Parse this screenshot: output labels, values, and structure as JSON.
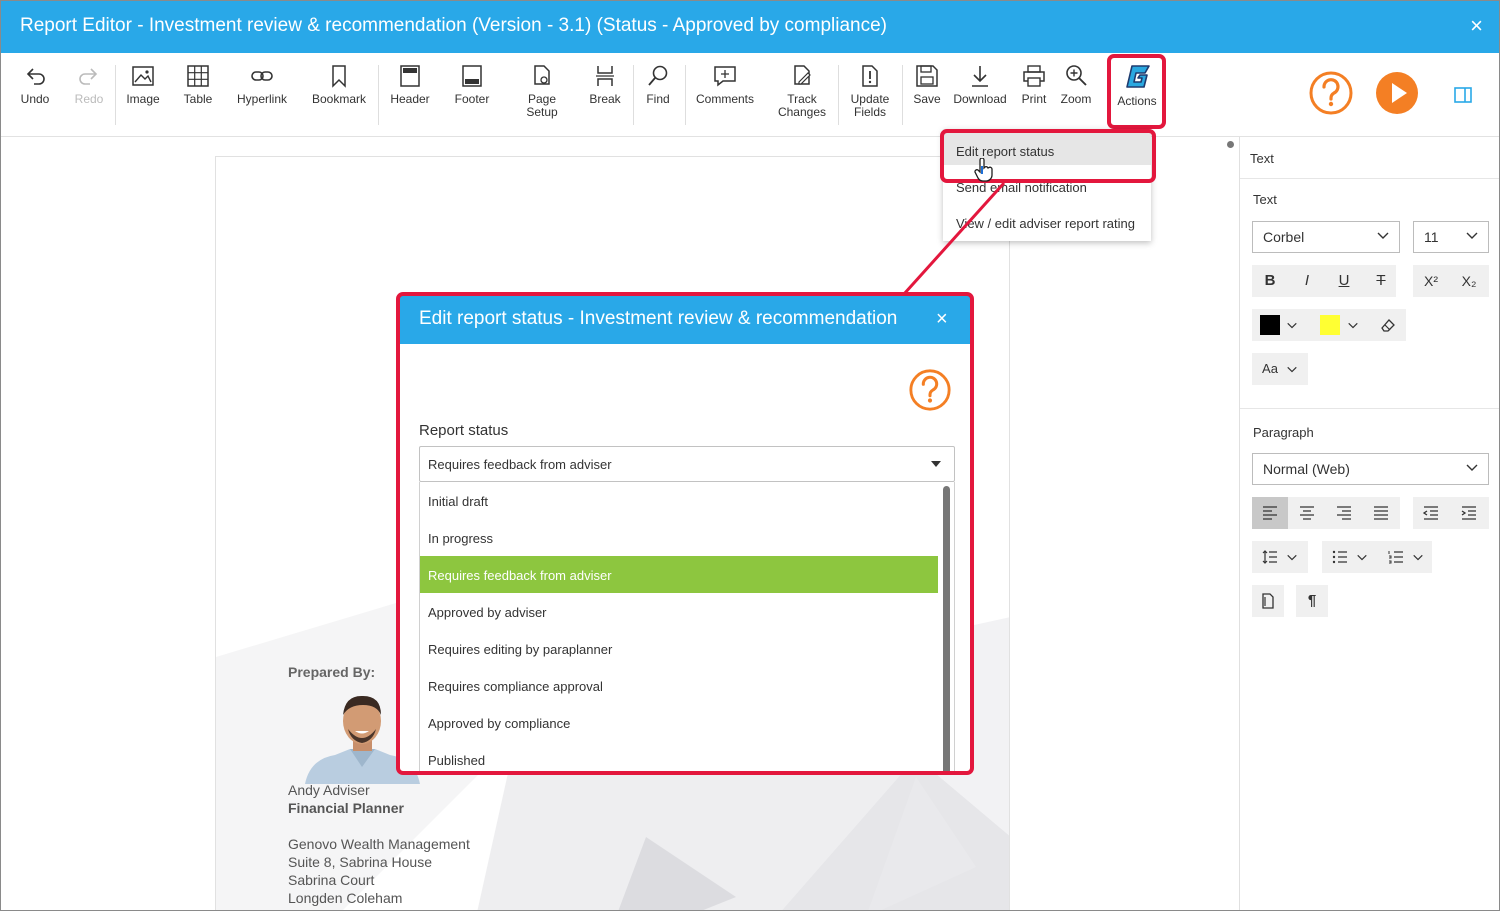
{
  "window": {
    "title": "Report Editor - Investment review & recommendation (Version - 3.1) (Status - Approved by compliance)",
    "close_icon": "×"
  },
  "toolbar": {
    "undo": "Undo",
    "redo": "Redo",
    "image": "Image",
    "table": "Table",
    "hyperlink": "Hyperlink",
    "bookmark": "Bookmark",
    "header": "Header",
    "footer": "Footer",
    "page_setup": "Page\nSetup",
    "break": "Break",
    "find": "Find",
    "comments": "Comments",
    "track_changes": "Track\nChanges",
    "update_fields": "Update\nFields",
    "save": "Save",
    "download": "Download",
    "print": "Print",
    "zoom": "Zoom",
    "actions": "Actions"
  },
  "actions_menu": {
    "items": [
      "Edit report status",
      "Send email notification",
      "View / edit adviser report rating"
    ]
  },
  "right_panel": {
    "tab": "Text",
    "text_section": "Text",
    "font": "Corbel",
    "font_size": "11",
    "bold": "B",
    "italic": "I",
    "underline": "U",
    "strike": "T",
    "superscript": "X²",
    "subscript": "X₂",
    "case": "Aa",
    "paragraph_section": "Paragraph",
    "paragraph_style": "Normal (Web)",
    "font_color": "#000000",
    "highlight_color": "#ffff33"
  },
  "document": {
    "prepared_by": "Prepared By:",
    "name": "Andy Adviser",
    "role": "Financial Planner",
    "company": "Genovo Wealth Management",
    "address1": "Suite 8, Sabrina House",
    "address2": "Sabrina Court",
    "address3": "Longden Coleham"
  },
  "dialog": {
    "title": "Edit report status - Investment review & recommendation",
    "close": "×",
    "field_label": "Report status",
    "selected": "Requires feedback from adviser",
    "options": [
      "Initial draft",
      "In progress",
      "Requires feedback from adviser",
      "Approved by adviser",
      "Requires editing by paraplanner",
      "Requires compliance approval",
      "Approved by compliance",
      "Published"
    ]
  },
  "colors": {
    "accent": "#29a8e8",
    "highlight": "#e3173d",
    "orange": "#f47f24",
    "selected_option": "#8dc63f"
  }
}
